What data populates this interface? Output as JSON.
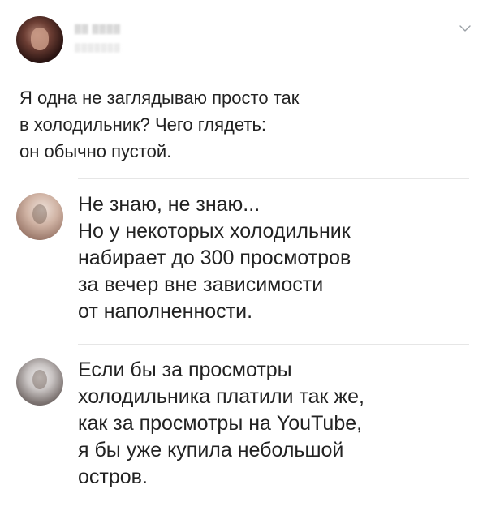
{
  "post": {
    "author_name": "▒▒ ▒▒▒▒",
    "author_meta": "▒▒▒▒▒▒▒",
    "text_lines": [
      "Я одна не заглядываю просто так",
      "в холодильник? Чего глядеть:",
      "он обычно пустой."
    ]
  },
  "comments": [
    {
      "text_lines": [
        "Не знаю, не знаю...",
        "Но у некоторых холодильник",
        "набирает до 300 просмотров",
        "за вечер вне зависимости",
        "от наполненности."
      ]
    },
    {
      "text_lines": [
        "Если бы за просмотры",
        "холодильника платили так же,",
        "как за просмотры на YouTube,",
        "я бы уже купила небольшой",
        "остров."
      ]
    }
  ],
  "icons": {
    "menu": "chevron-down-icon"
  },
  "colors": {
    "text": "#222222",
    "divider": "#e6e6e6",
    "chevron": "#9aa0a6",
    "background": "#ffffff"
  }
}
